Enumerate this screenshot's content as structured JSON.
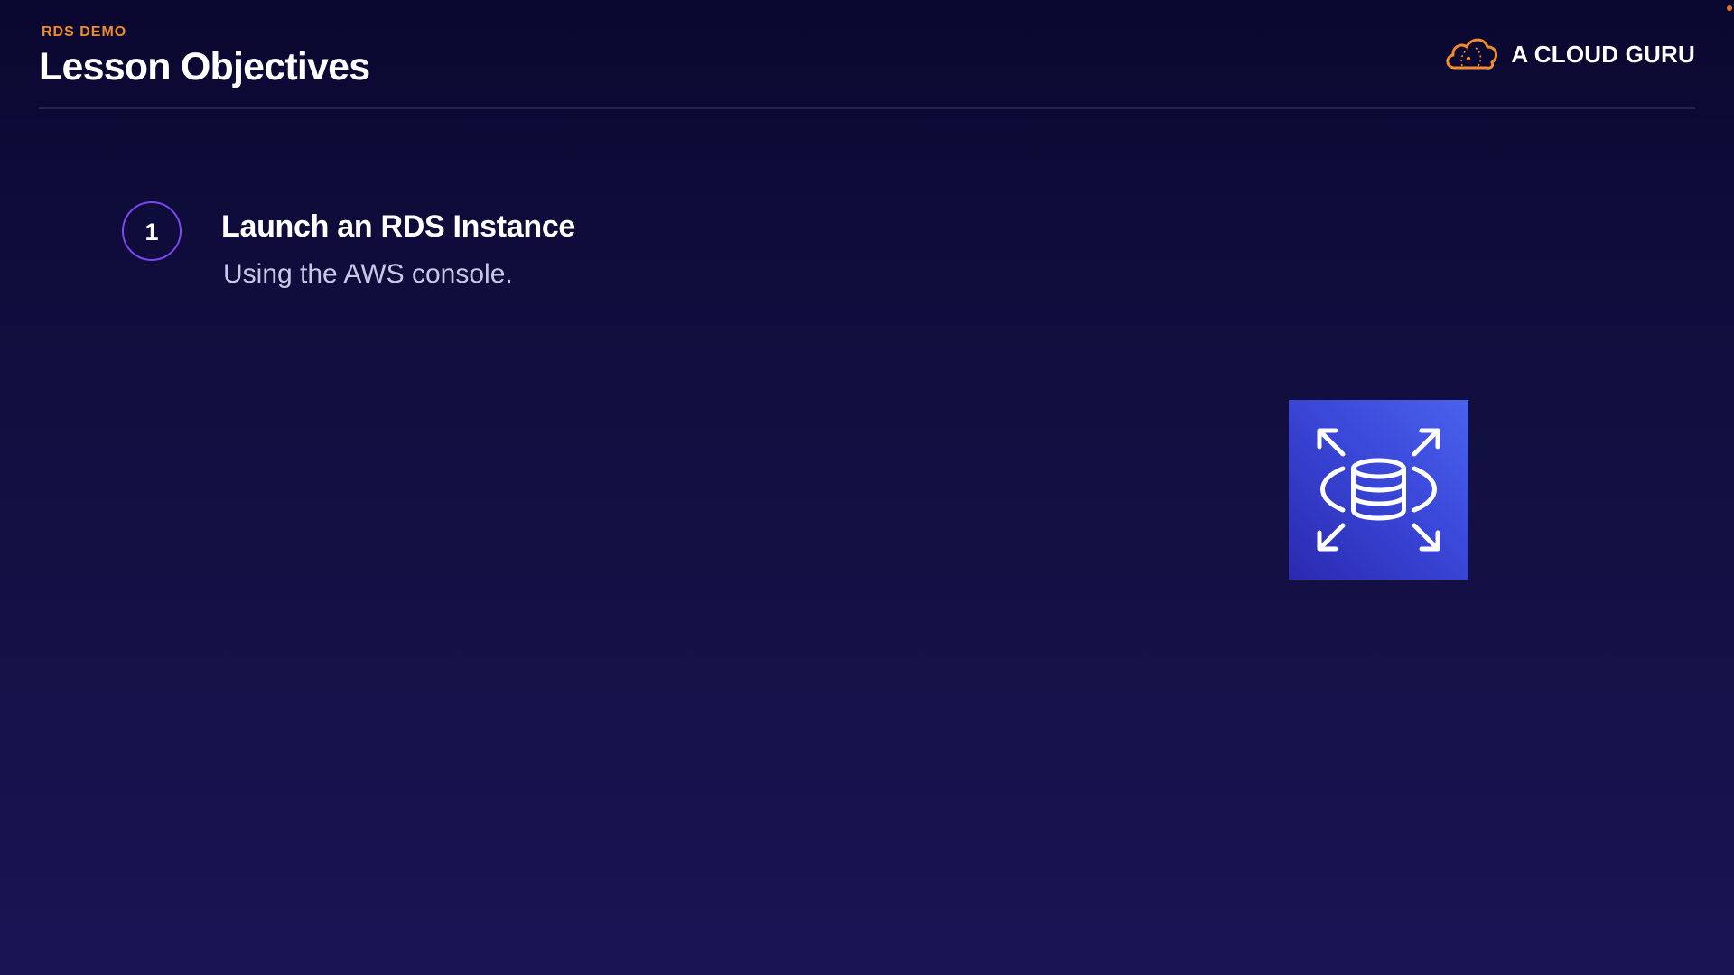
{
  "header": {
    "eyebrow": "RDS DEMO",
    "title": "Lesson Objectives",
    "brand_name": "A CLOUD GURU"
  },
  "objectives": [
    {
      "number": "1",
      "title": "Launch an RDS Instance",
      "subtitle": "Using the AWS console."
    }
  ],
  "icons": {
    "brand_logo": "cloud-logo-icon",
    "service": "amazon-rds-icon"
  },
  "colors": {
    "accent_orange": "#f28b2a",
    "badge_border": "#7b45f0",
    "rds_tile": "#3a47d8",
    "background": "#130f40"
  }
}
